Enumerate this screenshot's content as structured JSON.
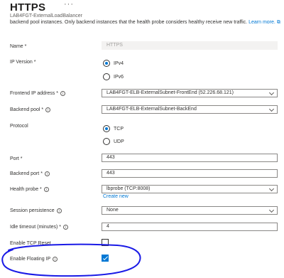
{
  "header": {
    "title": "HTTPS",
    "more": "···",
    "subtitle": "LAB4FGT-ExternalLoadBalancer",
    "description": "backend pool instances. Only backend instances that the health probe considers healthy receive new traffic.",
    "learn_more": "Learn more.",
    "external_link_icon": "external-link-icon"
  },
  "form": {
    "name": {
      "label": "Name",
      "required": "*",
      "value": "HTTPS"
    },
    "ip_version": {
      "label": "IP Version",
      "required": "*",
      "options": [
        "IPv4",
        "IPv6"
      ],
      "selected": "IPv4"
    },
    "frontend_ip": {
      "label": "Frontend IP address",
      "required": "*",
      "value": "LAB4FGT-ELB-ExternalSubnet-FrontEnd (52.226.68.121)"
    },
    "backend_pool": {
      "label": "Backend pool",
      "required": "*",
      "value": "LAB4FGT-ELB-ExternalSubnet-BackEnd"
    },
    "protocol": {
      "label": "Protocol",
      "options": [
        "TCP",
        "UDP"
      ],
      "selected": "TCP"
    },
    "port": {
      "label": "Port",
      "required": "*",
      "value": "443"
    },
    "backend_port": {
      "label": "Backend port",
      "required": "*",
      "value": "443"
    },
    "health_probe": {
      "label": "Health probe",
      "required": "*",
      "value": "lbprobe (TCP:8008)",
      "create_new": "Create new"
    },
    "session_persistence": {
      "label": "Session persistence",
      "value": "None"
    },
    "idle_timeout": {
      "label": "Idle timeout (minutes)",
      "required": "*",
      "value": "4"
    },
    "tcp_reset": {
      "label": "Enable TCP Reset",
      "checked": false
    },
    "floating_ip": {
      "label": "Enable Floating IP",
      "checked": true
    }
  },
  "annotation": {
    "color": "#1a1ae6"
  }
}
